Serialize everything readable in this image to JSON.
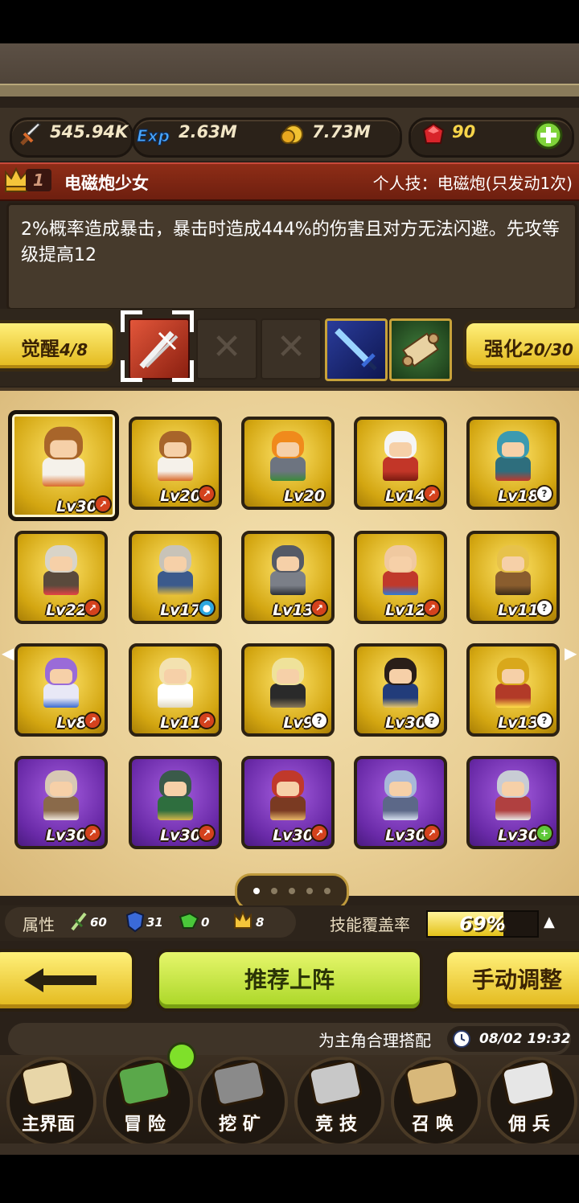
{
  "resources": {
    "attack": "545.94K",
    "exp": "2.63M",
    "gold": "7.73M",
    "gems": "90"
  },
  "hero": {
    "rank": "1",
    "name": "电磁炮少女",
    "skill": "个人技：电磁炮(只发动1次)",
    "description": "2%概率造成暴击，暴击时造成444%的伤害且对方无法闪避。先攻等级提高12"
  },
  "awaken": {
    "label": "觉醒",
    "value": "4/8",
    "enhance_label": "强化",
    "enhance_value": "20/30"
  },
  "heroes": [
    {
      "lv": "Lv30",
      "frame": "gold",
      "badge": "r",
      "hair": "#a8652a",
      "outfit": "#f5f1ea",
      "accent": "#d96a2a"
    },
    {
      "lv": "Lv20",
      "frame": "gold",
      "badge": "r",
      "hair": "#a8652a",
      "outfit": "#f5f1ea",
      "accent": "#d96a2a"
    },
    {
      "lv": "Lv20",
      "frame": "gold",
      "badge": "",
      "hair": "#f08a1c",
      "outfit": "#6d7480",
      "accent": "#3c8a3a"
    },
    {
      "lv": "Lv14",
      "frame": "gold",
      "badge": "r",
      "hair": "#f5f5f5",
      "outfit": "#c23628",
      "accent": "#7a1b10"
    },
    {
      "lv": "Lv18",
      "frame": "gold",
      "badge": "w",
      "hair": "#3c9ab0",
      "outfit": "#2e6e7d",
      "accent": "#c0392b"
    },
    {
      "lv": "Lv22",
      "frame": "gold",
      "badge": "r",
      "hair": "#d9d4c8",
      "outfit": "#5a4a3c",
      "accent": "#e44444"
    },
    {
      "lv": "Lv17",
      "frame": "gold",
      "badge": "b",
      "hair": "#c8c3b8",
      "outfit": "#3b5a8c",
      "accent": "#e0b93b"
    },
    {
      "lv": "Lv13",
      "frame": "gold",
      "badge": "r",
      "hair": "#555a66",
      "outfit": "#7b7f88",
      "accent": "#2b2f36"
    },
    {
      "lv": "Lv12",
      "frame": "gold",
      "badge": "r",
      "hair": "#f0c9a0",
      "outfit": "#c0392b",
      "accent": "#2e7bd6"
    },
    {
      "lv": "Lv11",
      "frame": "gold",
      "badge": "w",
      "hair": "#e7c24b",
      "outfit": "#8a5d2e",
      "accent": "#3a2a18"
    },
    {
      "lv": "Lv8",
      "frame": "gold",
      "badge": "r",
      "hair": "#9a6bd8",
      "outfit": "#e8e8f6",
      "accent": "#3b6bd0"
    },
    {
      "lv": "Lv11",
      "frame": "gold",
      "badge": "r",
      "hair": "#f3e2b0",
      "outfit": "#ffffff",
      "accent": "#e0d7c0"
    },
    {
      "lv": "Lv9",
      "frame": "gold",
      "badge": "w",
      "hair": "#efe29a",
      "outfit": "#2a2a2a",
      "accent": "#8a7a5a"
    },
    {
      "lv": "Lv30",
      "frame": "gold",
      "badge": "w",
      "hair": "#2a1e18",
      "outfit": "#223c7a",
      "accent": "#e6c66a"
    },
    {
      "lv": "Lv13",
      "frame": "gold",
      "badge": "w",
      "hair": "#d9a81b",
      "outfit": "#b23a28",
      "accent": "#ffdf4a"
    },
    {
      "lv": "Lv30",
      "frame": "purple",
      "badge": "r",
      "hair": "#d8c8b4",
      "outfit": "#8a6a4a",
      "accent": "#f0e8dc"
    },
    {
      "lv": "Lv30",
      "frame": "purple",
      "badge": "r",
      "hair": "#3a5a4a",
      "outfit": "#2e6e3e",
      "accent": "#d6b64a"
    },
    {
      "lv": "Lv30",
      "frame": "purple",
      "badge": "r",
      "hair": "#c0392b",
      "outfit": "#7a3a22",
      "accent": "#e8b86a"
    },
    {
      "lv": "Lv30",
      "frame": "purple",
      "badge": "r",
      "hair": "#a8b8d8",
      "outfit": "#5c6888",
      "accent": "#d8e0f0"
    },
    {
      "lv": "Lv30",
      "frame": "purple",
      "badge": "g",
      "hair": "#c8ccd4",
      "outfit": "#b04040",
      "accent": "#e8e8e8"
    }
  ],
  "attributes": {
    "label": "属性",
    "stat1": "60",
    "stat2": "31",
    "stat3": "0",
    "stat4": "8",
    "coverage_label": "技能覆盖率",
    "coverage_text": "69%",
    "coverage_value": 0.69
  },
  "buttons": {
    "recommend": "推荐上阵",
    "manual": "手动调整"
  },
  "ticker": {
    "text": "为主角合理搭配",
    "datetime": "08/02 19:32"
  },
  "nav": [
    {
      "label": "主界面"
    },
    {
      "label": "冒 险"
    },
    {
      "label": "挖 矿"
    },
    {
      "label": "竞 技"
    },
    {
      "label": "召 唤"
    },
    {
      "label": "佣 兵"
    }
  ]
}
